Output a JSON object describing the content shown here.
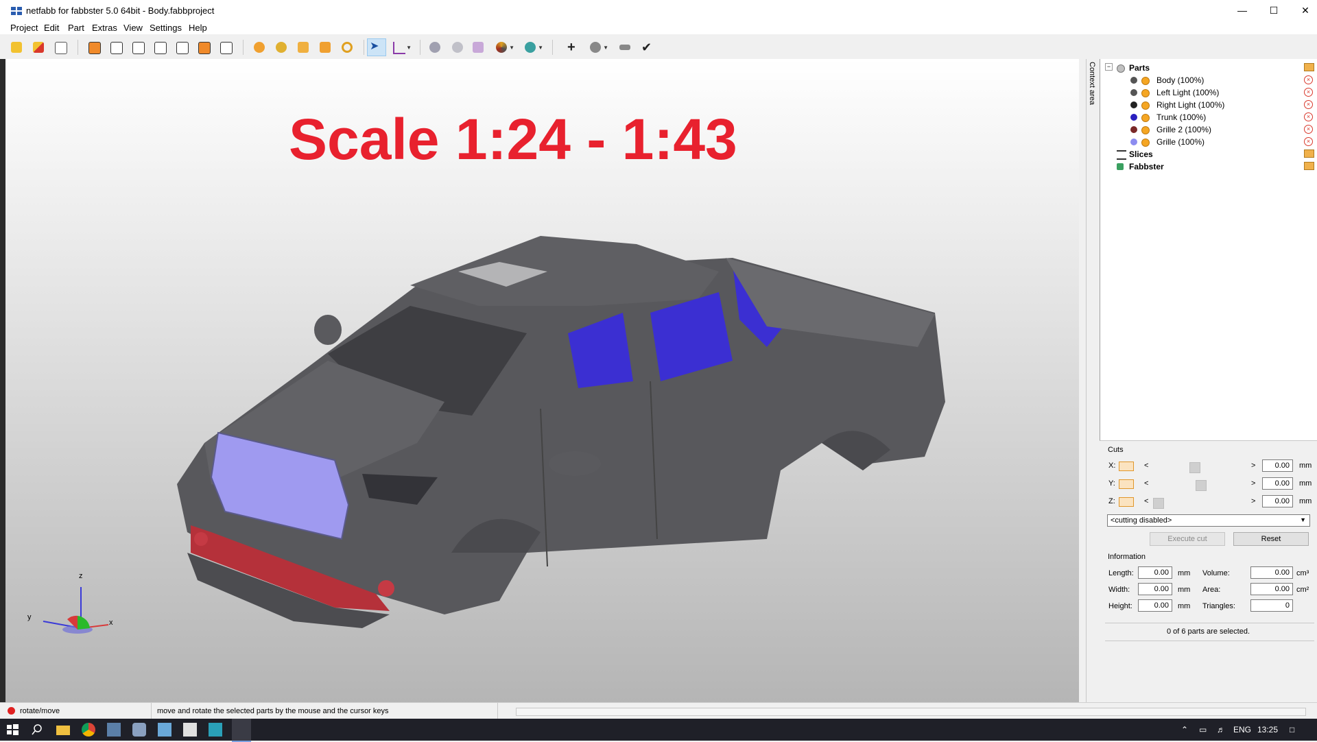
{
  "window": {
    "title": "netfabb for fabbster 5.0 64bit - Body.fabbproject",
    "minimize": "—",
    "maximize": "☐",
    "close": "✕"
  },
  "menu": [
    "Project",
    "Edit",
    "Part",
    "Extras",
    "View",
    "Settings",
    "Help"
  ],
  "toolbar_icons": [
    "open-project-icon",
    "add-part-icon",
    "print-preview-icon",
    "view-front-icon",
    "view-back-icon",
    "view-left-icon",
    "view-right-icon",
    "view-top-icon",
    "view-bottom-icon",
    "view-3d-icon",
    "zoom-all-icon",
    "zoom-selection-icon",
    "zoom-platform-icon",
    "zoom-window-icon",
    "zoom-icon",
    "select-pointer-icon",
    "measure-axis-icon",
    "shading-icon",
    "points-icon",
    "mesh-icon",
    "color-palette-icon",
    "repair-icon",
    "add-icon",
    "rotate-shading-icon",
    "ruler-icon",
    "checkmark-icon"
  ],
  "viewport": {
    "overlay_text": "Scale 1:24 - 1:43",
    "axis_labels": {
      "z": "z",
      "y": "y",
      "x": "x"
    },
    "colors": {
      "overlay": "#e8212e",
      "body": "#555559",
      "grille": "#9f9af0",
      "trunk": "#3b2fd2",
      "lights": "#b5313a"
    }
  },
  "context_tab": "Context area",
  "tree": {
    "root": "Parts",
    "expander": "−",
    "parts": [
      {
        "label": "Body (100%)",
        "color": "#555555"
      },
      {
        "label": "Left Light (100%)",
        "color": "#555555"
      },
      {
        "label": "Right Light (100%)",
        "color": "#222222"
      },
      {
        "label": "Trunk (100%)",
        "color": "#2a1fbf"
      },
      {
        "label": "Grille 2 (100%)",
        "color": "#7a2828"
      },
      {
        "label": "Grille (100%)",
        "color": "#8c8cf0"
      }
    ],
    "slices": "Slices",
    "fabbster": "Fabbster"
  },
  "cuts": {
    "title": "Cuts",
    "rows": [
      {
        "axis": "X:",
        "value": "0.00",
        "unit": "mm"
      },
      {
        "axis": "Y:",
        "value": "0.00",
        "unit": "mm"
      },
      {
        "axis": "Z:",
        "value": "0.00",
        "unit": "mm"
      }
    ],
    "left_arrow": "<",
    "right_arrow": ">",
    "mode": "<cutting disabled>",
    "execute": "Execute cut",
    "reset": "Reset"
  },
  "information": {
    "title": "Information",
    "length_label": "Length:",
    "length": "0.00",
    "length_unit": "mm",
    "width_label": "Width:",
    "width": "0.00",
    "width_unit": "mm",
    "height_label": "Height:",
    "height": "0.00",
    "height_unit": "mm",
    "volume_label": "Volume:",
    "volume": "0.00",
    "volume_unit": "cm³",
    "area_label": "Area:",
    "area": "0.00",
    "area_unit": "cm²",
    "triangles_label": "Triangles:",
    "triangles": "0",
    "selection": "0 of 6 parts are selected."
  },
  "status": {
    "mode": "rotate/move",
    "hint": "move and rotate the selected parts by the mouse and the cursor keys"
  },
  "taskbar": {
    "icons": [
      "windows-start-icon",
      "search-icon",
      "file-explorer-icon",
      "chrome-icon",
      "app-icon",
      "app-icon",
      "notepad-icon",
      "calculator-icon",
      "app-icon",
      "netfabb-icon"
    ],
    "lang": "ENG",
    "time": "13:25"
  }
}
